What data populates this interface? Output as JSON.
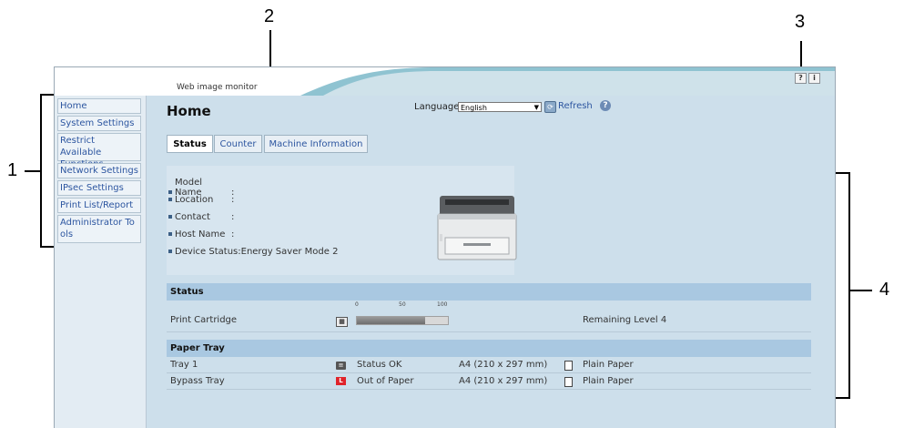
{
  "callouts": [
    "1",
    "2",
    "3",
    "4"
  ],
  "header": {
    "app_title": "Web image monitor",
    "help_icon": "?",
    "info_icon": "i"
  },
  "sidebar": {
    "items": [
      {
        "label": "Home"
      },
      {
        "label": "System Settings"
      },
      {
        "label": "Restrict Available Functions"
      },
      {
        "label": "Network Settings"
      },
      {
        "label": "IPsec Settings"
      },
      {
        "label": "Print List/Report"
      },
      {
        "label": "Administrator Tools"
      }
    ]
  },
  "main": {
    "title": "Home",
    "language_label": "Language",
    "language_value": "English",
    "refresh_label": "Refresh",
    "help_icon": "?",
    "tabs": [
      {
        "label": "Status"
      },
      {
        "label": "Counter"
      },
      {
        "label": "Machine Information"
      }
    ]
  },
  "device_info": [
    {
      "label": "Model Name",
      "value": ":"
    },
    {
      "label": "Location",
      "value": ":"
    },
    {
      "label": "Contact",
      "value": ":"
    },
    {
      "label": "Host Name",
      "value": ":"
    },
    {
      "label": "Device Status",
      "value": ":Energy Saver Mode 2"
    }
  ],
  "status_section": {
    "header": "Status",
    "scale_ticks": [
      "0",
      "50",
      "100"
    ],
    "cartridge_label": "Print Cartridge",
    "cartridge_level_fraction": 0.75,
    "remaining": "Remaining Level 4"
  },
  "paper_tray_section": {
    "header": "Paper Tray",
    "rows": [
      {
        "name": "Tray 1",
        "status": "Status OK",
        "size": "A4 (210 x 297 mm)",
        "type": "Plain Paper",
        "status_color": "#333333"
      },
      {
        "name": "Bypass Tray",
        "status": "Out of Paper",
        "size": "A4 (210 x 297 mm)",
        "type": "Plain Paper",
        "status_color": "#e0242b"
      }
    ]
  }
}
